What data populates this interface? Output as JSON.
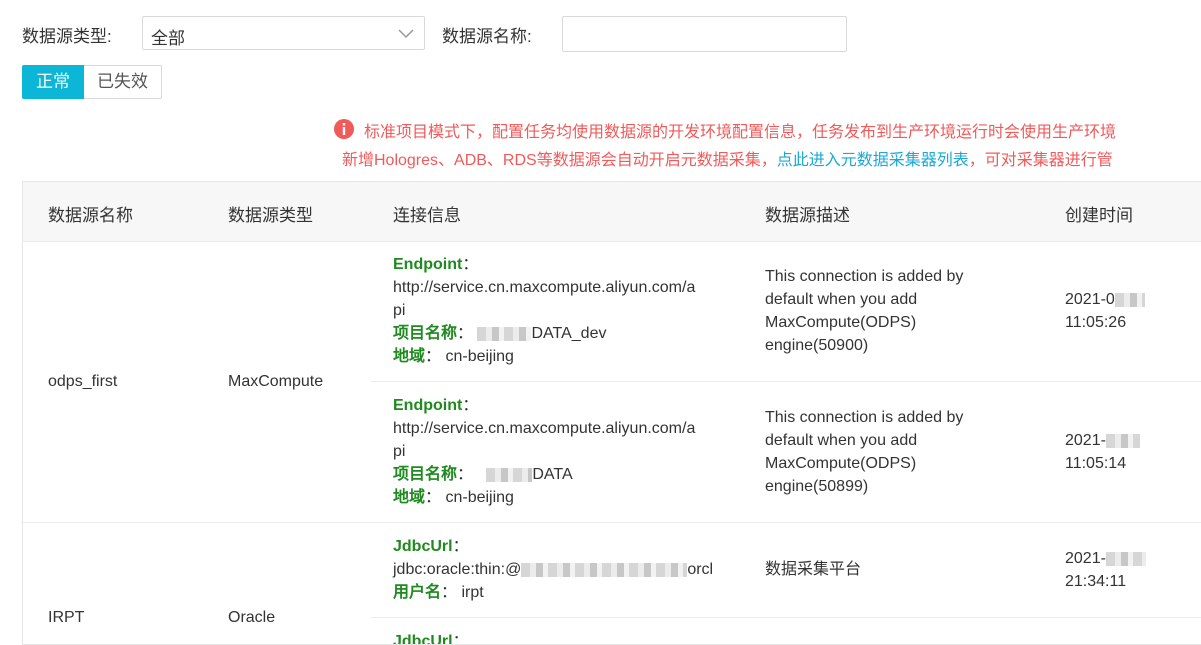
{
  "filters": {
    "type_label": "数据源类型:",
    "type_value": "全部",
    "name_label": "数据源名称:",
    "name_value": ""
  },
  "status_tabs": [
    "正常",
    "已失效"
  ],
  "notice": {
    "line1": "标准项目模式下，配置任务均使用数据源的开发环境配置信息，任务发布到生产环境运行时会使用生产环境",
    "line2_prefix": "新增Hologres、ADB、RDS等数据源会自动开启元数据采集，",
    "line2_link": "点此进入元数据采集器列表",
    "line2_suffix": "，可对采集器进行管"
  },
  "table": {
    "headers": [
      "数据源名称",
      "数据源类型",
      "连接信息",
      "数据源描述",
      "创建时间"
    ],
    "groups": [
      {
        "name": "odps_first",
        "type": "MaxCompute",
        "rows": [
          {
            "endpoint_key": "Endpoint",
            "url_line1": "http://service.cn.maxcompute.aliyun.com/a",
            "url_line2": "pi",
            "project_key": "项目名称",
            "project_suffix": "DATA_dev",
            "region_key": "地域",
            "region_value": "cn-beijing",
            "desc_lines": [
              "This connection is added by",
              "default when you add",
              "MaxCompute(ODPS)",
              "engine(50900)"
            ],
            "created_date": "2021-0",
            "created_time": "11:05:26"
          },
          {
            "endpoint_key": "Endpoint",
            "url_line1": "http://service.cn.maxcompute.aliyun.com/a",
            "url_line2": "pi",
            "project_key": "项目名称",
            "project_suffix": "DATA",
            "region_key": "地域",
            "region_value": "cn-beijing",
            "desc_lines": [
              "This connection is added by",
              "default when you add",
              "MaxCompute(ODPS)",
              "engine(50899)"
            ],
            "created_date": "2021-",
            "created_time": "11:05:14"
          }
        ]
      },
      {
        "name": "IRPT",
        "type": "Oracle",
        "rows": [
          {
            "jdbc_key": "JdbcUrl",
            "jdbc_prefix": "jdbc:oracle:thin:@",
            "jdbc_suffix": "orcl",
            "user_key": "用户名",
            "user_value": "irpt",
            "desc": "数据采集平台",
            "created_date": "2021-",
            "created_time": "21:34:11"
          },
          {
            "jdbc_key": "JdbcUrl"
          }
        ]
      }
    ]
  },
  "colors": {
    "accent": "#0cb6d6",
    "notice": "#f05a5a",
    "link": "#1aa9d4",
    "key_green": "#1f8a1f"
  }
}
